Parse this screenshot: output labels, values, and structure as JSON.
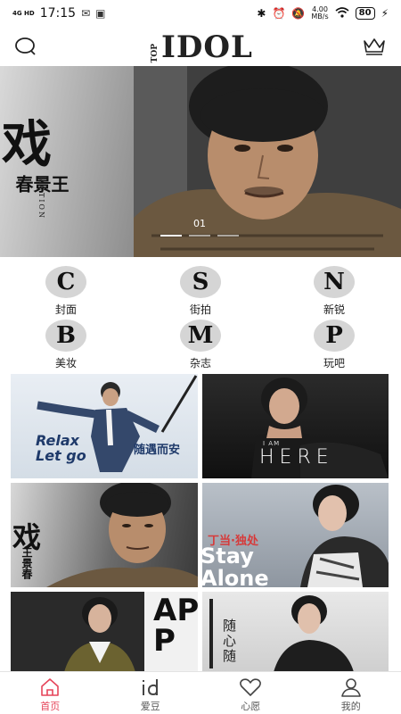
{
  "status_bar": {
    "network": "4G HD",
    "time": "17:15",
    "speed_value": "4.00",
    "speed_unit": "MB/s",
    "battery": "80"
  },
  "header": {
    "logo_small": "TOP",
    "logo_main": "IDOL",
    "search_icon": "search-icon",
    "crown_icon": "crown-icon"
  },
  "banner": {
    "calligraphy": "戏",
    "name": "王景春",
    "subtitle": "ACTION",
    "page_index": "01"
  },
  "categories": [
    {
      "letter": "C",
      "label": "封面"
    },
    {
      "letter": "S",
      "label": "街拍"
    },
    {
      "letter": "N",
      "label": "新锐"
    },
    {
      "letter": "B",
      "label": "美妆"
    },
    {
      "letter": "M",
      "label": "杂志"
    },
    {
      "letter": "P",
      "label": "玩吧"
    }
  ],
  "cards": [
    {
      "text": "Relax Let go",
      "text2": "随遇而安"
    },
    {
      "text": "I AM",
      "text2": "HERE"
    },
    {
      "text": "戏",
      "text2": "王景春"
    },
    {
      "text": "丁当·独处",
      "text2": "Stay Alone"
    },
    {
      "text": "APP",
      "text2": ""
    },
    {
      "text": "随心随",
      "text2": ""
    }
  ],
  "bottom_nav": [
    {
      "label": "首页",
      "icon": "home-icon",
      "active": true
    },
    {
      "label": "爱豆",
      "icon": "idol-icon",
      "active": false
    },
    {
      "label": "心愿",
      "icon": "heart-icon",
      "active": false
    },
    {
      "label": "我的",
      "icon": "user-icon",
      "active": false
    }
  ],
  "colors": {
    "accent": "#e6455a",
    "circle_bg": "#d5d5d5"
  }
}
